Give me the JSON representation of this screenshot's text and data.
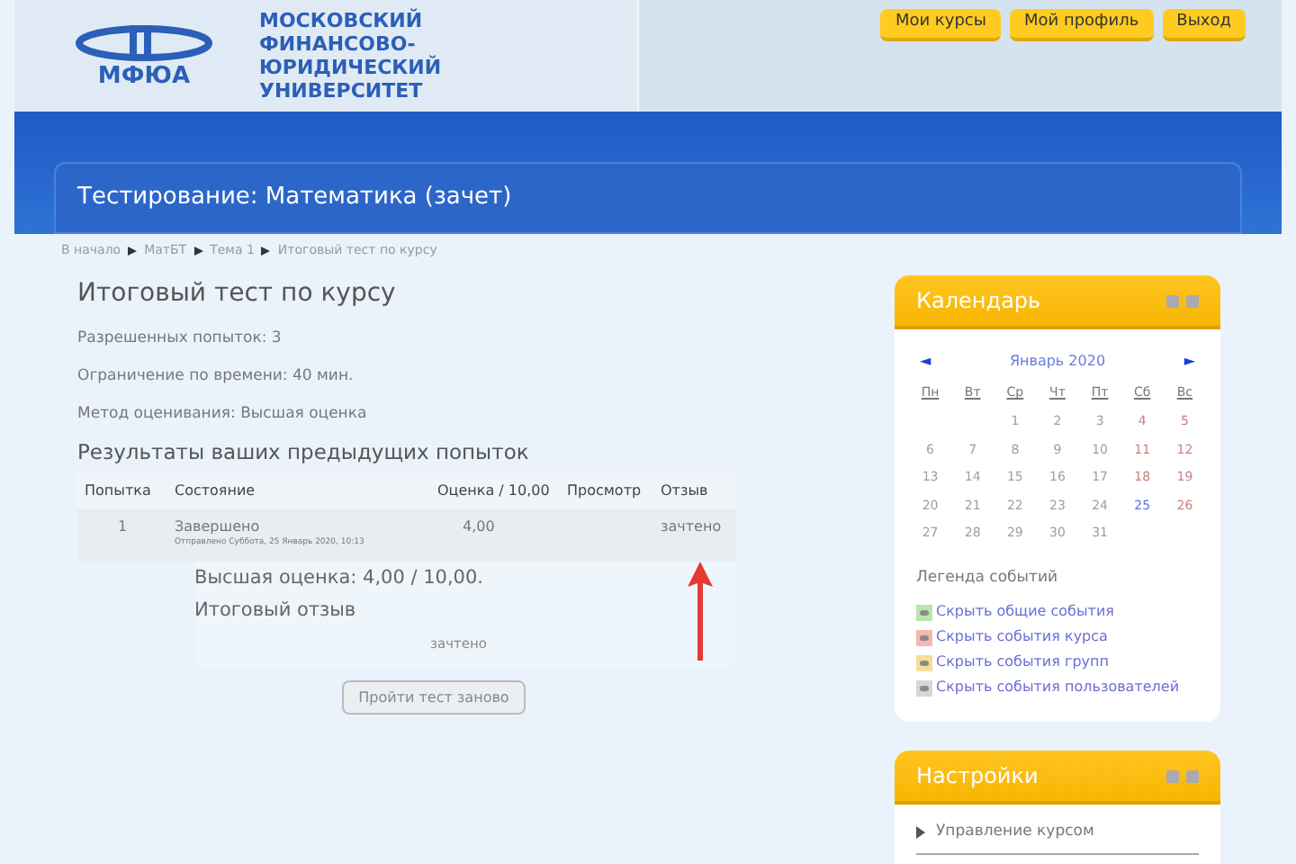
{
  "header": {
    "logo_text": "МФЮА",
    "university_lines": [
      "МОСКОВСКИЙ",
      "ФИНАНСОВО-",
      "ЮРИДИЧЕСКИЙ",
      "УНИВЕРСИТЕТ"
    ],
    "buttons": [
      "Мои курсы",
      "Мой профиль",
      "Выход"
    ]
  },
  "page_title": "Тестирование: Математика (зачет)",
  "breadcrumb": [
    {
      "label": "В начало"
    },
    {
      "label": "МатБТ"
    },
    {
      "label": "Тема 1"
    },
    {
      "label": "Итоговый тест по курсу"
    }
  ],
  "quiz": {
    "title": "Итоговый тест по курсу",
    "info": [
      "Разрешенных попыток: 3",
      "Ограничение по времени: 40 мин.",
      "Метод оценивания: Высшая оценка"
    ],
    "results_heading": "Результаты ваших предыдущих попыток",
    "table": {
      "columns": [
        "Попытка",
        "Состояние",
        "Оценка / 10,00",
        "Просмотр",
        "Отзыв"
      ],
      "rows": [
        {
          "attempt": "1",
          "state": "Завершено",
          "submitted": "Отправлено Суббота, 25 Январь 2020, 10:13",
          "grade": "4,00",
          "feedback": "зачтено"
        }
      ]
    },
    "highest_grade": "Высшая оценка: 4,00 / 10,00.",
    "final_feedback_heading": "Итоговый отзыв",
    "final_feedback": "зачтено",
    "retry_button": "Пройти тест заново"
  },
  "calendar": {
    "title": "Календарь",
    "month": "Январь 2020",
    "prev": "◄",
    "next": "►",
    "weekdays": [
      "Пн",
      "Вт",
      "Ср",
      "Чт",
      "Пт",
      "Сб",
      "Вс"
    ],
    "days": [
      {
        "kind": "blank"
      },
      {
        "kind": "blank"
      },
      {
        "label": "1",
        "kind": "normal"
      },
      {
        "label": "2",
        "kind": "normal"
      },
      {
        "label": "3",
        "kind": "normal"
      },
      {
        "label": "4",
        "kind": "weekend"
      },
      {
        "label": "5",
        "kind": "weekend"
      },
      {
        "label": "6",
        "kind": "normal"
      },
      {
        "label": "7",
        "kind": "normal"
      },
      {
        "label": "8",
        "kind": "normal"
      },
      {
        "label": "9",
        "kind": "normal"
      },
      {
        "label": "10",
        "kind": "normal"
      },
      {
        "label": "11",
        "kind": "weekend"
      },
      {
        "label": "12",
        "kind": "weekend"
      },
      {
        "label": "13",
        "kind": "normal"
      },
      {
        "label": "14",
        "kind": "normal"
      },
      {
        "label": "15",
        "kind": "normal"
      },
      {
        "label": "16",
        "kind": "normal"
      },
      {
        "label": "17",
        "kind": "normal"
      },
      {
        "label": "18",
        "kind": "weekend"
      },
      {
        "label": "19",
        "kind": "weekend"
      },
      {
        "label": "20",
        "kind": "normal"
      },
      {
        "label": "21",
        "kind": "normal"
      },
      {
        "label": "22",
        "kind": "normal"
      },
      {
        "label": "23",
        "kind": "normal"
      },
      {
        "label": "24",
        "kind": "normal"
      },
      {
        "label": "25",
        "kind": "event"
      },
      {
        "label": "26",
        "kind": "weekend"
      },
      {
        "label": "27",
        "kind": "normal"
      },
      {
        "label": "28",
        "kind": "normal"
      },
      {
        "label": "29",
        "kind": "normal"
      },
      {
        "label": "30",
        "kind": "normal"
      },
      {
        "label": "31",
        "kind": "normal"
      }
    ],
    "legend_title": "Легенда событий",
    "legend": [
      {
        "label": "Скрыть общие события",
        "color": "#b9e6b0"
      },
      {
        "label": "Скрыть события курса",
        "color": "#f4b8b0"
      },
      {
        "label": "Скрыть события групп",
        "color": "#f6dd9a"
      },
      {
        "label": "Скрыть события пользователей",
        "color": "#d3d8de"
      }
    ]
  },
  "settings": {
    "title": "Настройки",
    "items": [
      {
        "label": "Управление курсом"
      }
    ]
  }
}
